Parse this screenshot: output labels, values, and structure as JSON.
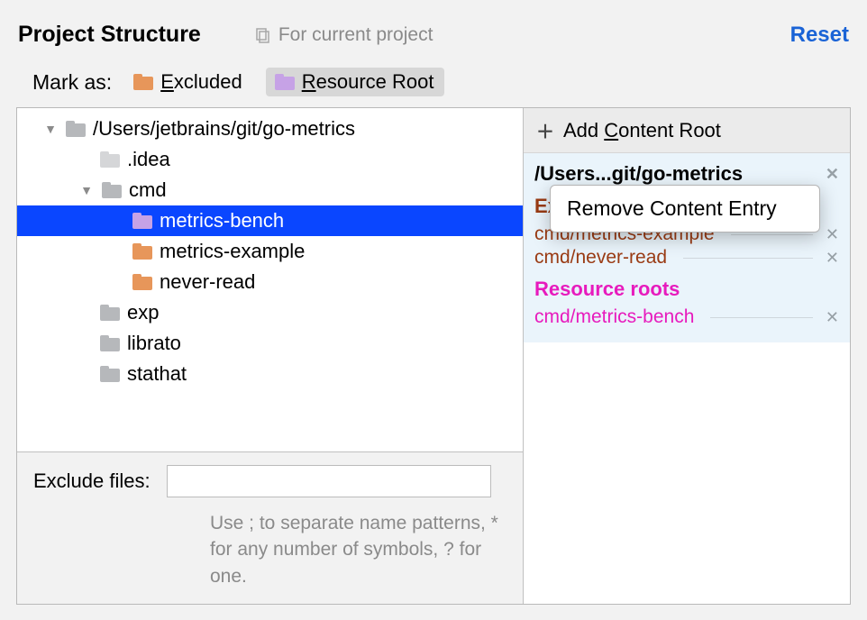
{
  "title": "Project Structure",
  "for_current_label": "For current project",
  "reset_label": "Reset",
  "markas": {
    "label": "Mark as:",
    "excluded": "Excluded",
    "resource_root": "Resource Root"
  },
  "tree": {
    "root": "/Users/jetbrains/git/go-metrics",
    "idea": ".idea",
    "cmd": "cmd",
    "metrics_bench": "metrics-bench",
    "metrics_example": "metrics-example",
    "never_read": "never-read",
    "exp": "exp",
    "librato": "librato",
    "stathat": "stathat"
  },
  "exclude": {
    "label": "Exclude files:",
    "value": "",
    "placeholder": "",
    "help": "Use ; to separate name patterns, * for any number of symbols, ? for one."
  },
  "right": {
    "add_content_root": "Add Content Root",
    "content_root_path": "/Users...git/go-metrics",
    "excluded_header": "Excluded Folders",
    "excluded": [
      "cmd/metrics-example",
      "cmd/never-read"
    ],
    "resource_header": "Resource roots",
    "resource": [
      "cmd/metrics-bench"
    ]
  },
  "popup": {
    "remove_content_entry": "Remove Content Entry"
  }
}
